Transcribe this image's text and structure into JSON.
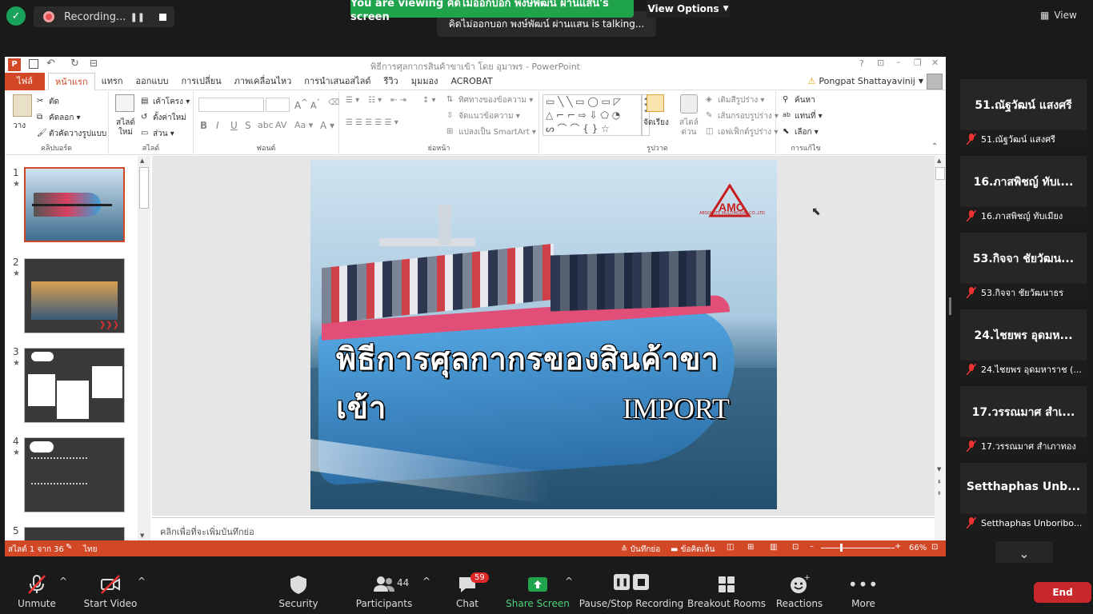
{
  "top": {
    "recording_label": "Recording...",
    "viewing_banner": "You are viewing คิดไม่ออกบอก พงษ์พัฒน์ ผ่านแสน's screen",
    "talking_text": "คิดไม่ออกบอก พงษ์พัฒน์ ผ่านแสน is talking...",
    "view_options_label": "View Options",
    "view_label": "View"
  },
  "ppt": {
    "window_title": "พิธีการศุลกากรสินค้าขาเข้า โดย อุมาพร - PowerPoint",
    "tabs": [
      "ไฟล์",
      "หน้าแรก",
      "แทรก",
      "ออกแบบ",
      "การเปลี่ยน",
      "ภาพเคลื่อนไหว",
      "การนำเสนอสไลด์",
      "รีวิว",
      "มุมมอง",
      "ACROBAT"
    ],
    "user": "Pongpat Shattayavinij",
    "ribbon": {
      "paste": "วาง",
      "cut": "ตัด",
      "copy": "คัดลอก",
      "format_painter": "ตัวคัดวางรูปแบบ",
      "clipboard": "คลิปบอร์ด",
      "new_slide": "สไลด์ใหม่",
      "layout": "เค้าโครง",
      "reset": "ตั้งค่าใหม่",
      "section": "ส่วน",
      "slides": "สไลด์",
      "font": "ฟอนต์",
      "text_direction": "ทิศทางของข้อความ",
      "align_text": "จัดแนวข้อความ",
      "smartart": "แปลงเป็น SmartArt",
      "paragraph": "ย่อหน้า",
      "arrange": "จัดเรียง",
      "quick_styles": "สไตล์ด่วน",
      "shape_fill": "เติมสีรูปร่าง",
      "shape_outline": "เส้นกรอบรูปร่าง",
      "shape_effects": "เอฟเฟ็กต์รูปร่าง",
      "drawing": "รูปวาด",
      "find": "ค้นหา",
      "replace": "แทนที่",
      "select": "เลือก",
      "editing": "การแก้ไข"
    },
    "slide_numbers": [
      "1",
      "2",
      "3",
      "4",
      "5"
    ],
    "slide_thai_title": "พิธีการศุลกากรของสินค้าขาเข้า",
    "slide_import": "IMPORT",
    "slide_logo_text": "ABSOLUTE MULTIMODAL CO.,LTD.",
    "notes_placeholder": "คลิกเพื่อที่จะเพิ่มบันทึกย่อ",
    "status_slide": "สไลด์ 1 จาก 36",
    "status_lang": "ไทย",
    "status_notes": "บันทึกย่อ",
    "status_comments": "ข้อคิดเห็น",
    "zoom": "66%"
  },
  "participants": [
    {
      "name": "51.ณัฐวัฒน์ แสงศรี",
      "sub": "51.ณัฐวัฒน์ แสงศรี"
    },
    {
      "name": "16.ภาสพิชญ์ ทับเ...",
      "sub": "16.ภาสพิชญ์ ทับเมียง"
    },
    {
      "name": "53.กิจจา ชัยวัฒน...",
      "sub": "53.กิจจา ชัยวัฒนาธร"
    },
    {
      "name": "24.ไชยพร อุดมห...",
      "sub": "24.ไชยพร อุดมหาราช (..."
    },
    {
      "name": "17.วรรณมาศ สำเ...",
      "sub": "17.วรรณมาศ สำเภาทอง"
    },
    {
      "name": "Setthaphas Unb...",
      "sub": "Setthaphas Unboribo..."
    }
  ],
  "toolbar": {
    "unmute": "Unmute",
    "start_video": "Start Video",
    "security": "Security",
    "participants": "Participants",
    "participants_count": "44",
    "chat": "Chat",
    "chat_badge": "59",
    "share_screen": "Share Screen",
    "pause_recording": "Pause/Stop Recording",
    "breakout": "Breakout Rooms",
    "reactions": "Reactions",
    "more": "More",
    "end": "End"
  },
  "colors": {
    "ppt_accent": "#d24726",
    "zoom_green": "#1fa44c",
    "end_red": "#c8282b",
    "share_green": "#1fa44c",
    "chat_badge": "#e02828"
  }
}
